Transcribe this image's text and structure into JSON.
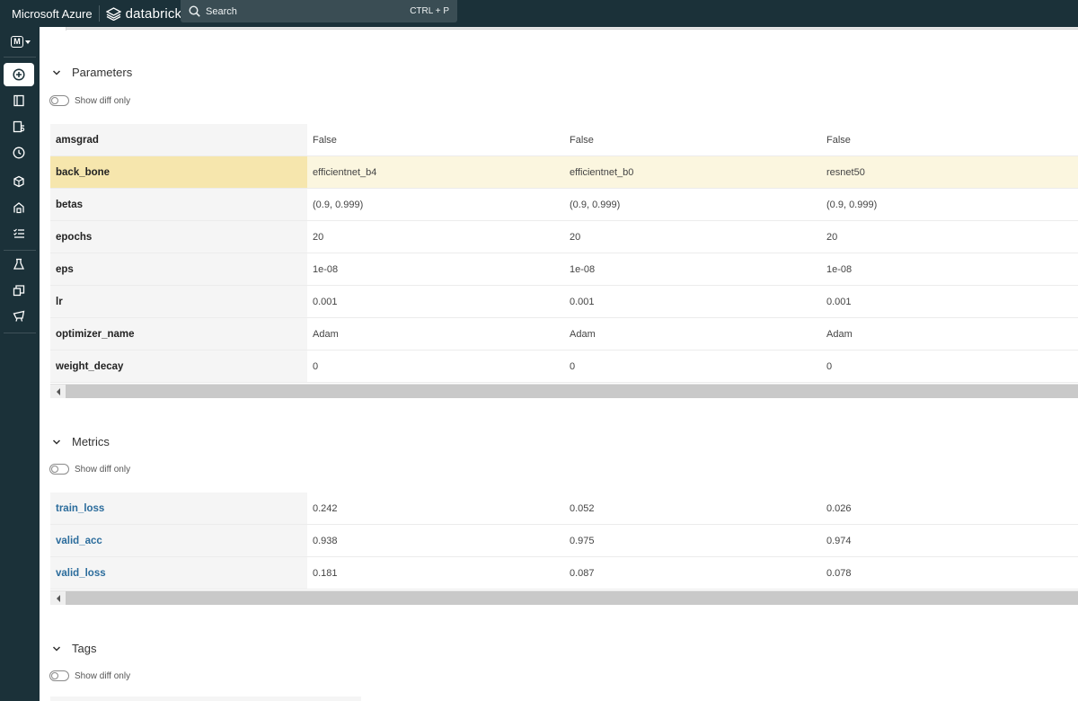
{
  "header": {
    "brand_left": "Microsoft Azure",
    "brand_product": "databricks",
    "search": {
      "placeholder": "Search",
      "shortcut": "CTRL + P"
    }
  },
  "sidebar": {
    "workspace_letter": "M",
    "items": [
      {
        "name": "new",
        "active": true
      },
      {
        "name": "workspace"
      },
      {
        "name": "repos"
      },
      {
        "name": "recents"
      },
      {
        "name": "data"
      },
      {
        "name": "compute"
      },
      {
        "name": "workflows"
      },
      {
        "name": "experiments"
      },
      {
        "name": "feature-store"
      },
      {
        "name": "models"
      }
    ]
  },
  "parameters": {
    "title": "Parameters",
    "toggle_label": "Show diff only",
    "rows": [
      {
        "key": "amsgrad",
        "values": [
          "False",
          "False",
          "False"
        ]
      },
      {
        "key": "back_bone",
        "values": [
          "efficientnet_b4",
          "efficientnet_b0",
          "resnet50"
        ],
        "highlight": true
      },
      {
        "key": "betas",
        "values": [
          "(0.9, 0.999)",
          "(0.9, 0.999)",
          "(0.9, 0.999)"
        ]
      },
      {
        "key": "epochs",
        "values": [
          "20",
          "20",
          "20"
        ]
      },
      {
        "key": "eps",
        "values": [
          "1e-08",
          "1e-08",
          "1e-08"
        ]
      },
      {
        "key": "lr",
        "values": [
          "0.001",
          "0.001",
          "0.001"
        ]
      },
      {
        "key": "optimizer_name",
        "values": [
          "Adam",
          "Adam",
          "Adam"
        ]
      },
      {
        "key": "weight_decay",
        "values": [
          "0",
          "0",
          "0"
        ]
      }
    ]
  },
  "metrics": {
    "title": "Metrics",
    "toggle_label": "Show diff only",
    "rows": [
      {
        "key": "train_loss",
        "values": [
          "0.242",
          "0.052",
          "0.026"
        ]
      },
      {
        "key": "valid_acc",
        "values": [
          "0.938",
          "0.975",
          "0.974"
        ]
      },
      {
        "key": "valid_loss",
        "values": [
          "0.181",
          "0.087",
          "0.078"
        ]
      }
    ]
  },
  "tags": {
    "title": "Tags",
    "toggle_label": "Show diff only"
  }
}
